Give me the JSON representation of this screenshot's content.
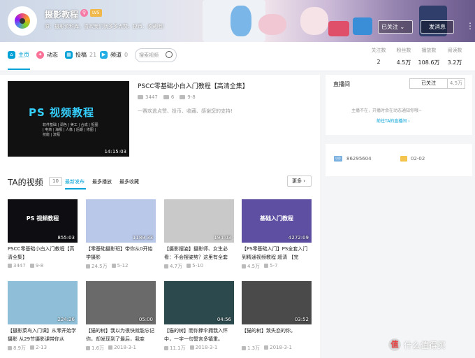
{
  "header": {
    "username": "摄影教程",
    "gender_icon": "♀",
    "level": "LV5",
    "signature": "原：摄影资料库，喜欢我们就多多点赞、投币、收藏哦！",
    "follow_label": "已关注",
    "message_label": "发消息",
    "more_icon": "⋮"
  },
  "nav": {
    "tabs": [
      {
        "label": "主页",
        "count": ""
      },
      {
        "label": "动态",
        "count": ""
      },
      {
        "label": "投稿",
        "count": "21"
      },
      {
        "label": "频道",
        "count": "0"
      }
    ],
    "search_placeholder": "搜索视频"
  },
  "stats": [
    {
      "label": "关注数",
      "value": "2"
    },
    {
      "label": "粉丝数",
      "value": "4.5万"
    },
    {
      "label": "播放数",
      "value": "108.6万"
    },
    {
      "label": "阅读数",
      "value": "3.2万"
    }
  ],
  "featured": {
    "thumb_title": "PS 视频教程",
    "thumb_sub": "软件基础 | 调色 | 美工 | 合成 | 抠图 | 电商 | 海报 | 人像 | 后期 | 修图 | 技能 | 流程",
    "duration": "14:15:03",
    "title": "PSCC零基础小白入门教程【高清全集】",
    "plays": "3447",
    "danmaku": "6",
    "date": "9-8",
    "desc": "一赛欢逃点赞、投币、收藏、感谢您的支持!"
  },
  "videos_section": {
    "title": "TA的视频",
    "count": "10",
    "sorts": [
      "最新发布",
      "最多播放",
      "最多收藏"
    ],
    "more_label": "更多"
  },
  "videos": [
    {
      "thumb_text": "PS 视频教程",
      "duration": "855:03",
      "title": "PSCC零基础小白入门教程【高清全集】",
      "plays": "3447",
      "date": "9-8",
      "thumb_color": "#0d0d12"
    },
    {
      "thumb_text": "",
      "duration": "1189:33",
      "title": "【零基础摄影班】带你从0开始学摄影",
      "plays": "24.5万",
      "date": "5-12",
      "thumb_color": "#b9c7e8"
    },
    {
      "thumb_text": "",
      "duration": "194:03",
      "title": "【摄影摆姿】摄影师、女生必看：不会摆姿势？这里有全套",
      "plays": "4.7万",
      "date": "5-10",
      "thumb_color": "#c9c9c9"
    },
    {
      "thumb_text": "基础入门教程",
      "duration": "4272:09",
      "title": "【PS零基础入门】PS全套入门到精通视频教程 超清 【完",
      "plays": "4.5万",
      "date": "5-7",
      "thumb_color": "#5e4fa2"
    },
    {
      "thumb_text": "",
      "duration": "224:26",
      "title": "【摄影菜鸟入门课】从零开始学摄影 从29节摄影课带你从",
      "plays": "8.9万",
      "date": "2-13",
      "thumb_color": "#8fbfd8"
    },
    {
      "thumb_text": "",
      "duration": "05:00",
      "title": "【猫的树】我以为很快就能忘记你，却发现到了最后，我变",
      "plays": "1.6万",
      "date": "2018-3-1",
      "thumb_color": "#6a6a6a"
    },
    {
      "thumb_text": "",
      "duration": "04:56",
      "title": "【猫的树】而你撑伞拥我入怀中，一字一句誓言多镇重。",
      "plays": "11.1万",
      "date": "2018-3-1",
      "thumb_color": "#2c4a4e"
    },
    {
      "thumb_text": "",
      "duration": "03:52",
      "title": "【猫的树】致失恋的你。",
      "plays": "1.3万",
      "date": "2018-3-1",
      "thumb_color": "#4a4a4a"
    }
  ],
  "live": {
    "title": "直播间",
    "follow_label": "已关注",
    "count": "4.5万",
    "notice": "主播不在，开播时会在动态通知你哦~",
    "link": "前往TA的直播间"
  },
  "info": {
    "uid_badge": "UID",
    "uid": "86295604",
    "birthday": "02-02"
  },
  "watermark": {
    "icon": "值",
    "text": "什么值得买"
  },
  "colors": {
    "accent": "#00a1d6"
  }
}
